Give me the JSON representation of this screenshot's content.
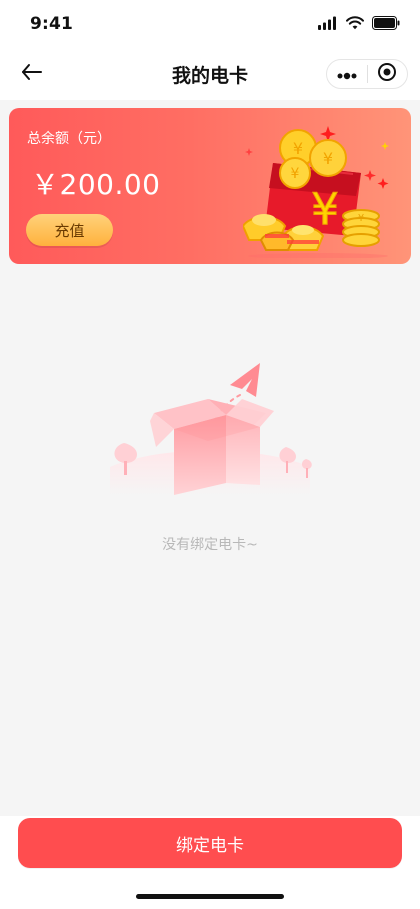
{
  "status_bar": {
    "time": "9:41"
  },
  "nav": {
    "title": "我的电卡"
  },
  "balance_card": {
    "label": "总余额（元）",
    "amount": "￥200.00",
    "recharge_label": "充值",
    "accent_color": "#ff5a5a"
  },
  "empty_state": {
    "message": "没有绑定电卡~"
  },
  "footer": {
    "bind_button_label": "绑定电卡",
    "button_color": "#ff4d4f"
  },
  "icons": {
    "back": "back-arrow-icon",
    "more": "more-dots-icon",
    "close": "target-close-icon",
    "signal": "signal-icon",
    "wifi": "wifi-icon",
    "battery": "battery-icon"
  }
}
